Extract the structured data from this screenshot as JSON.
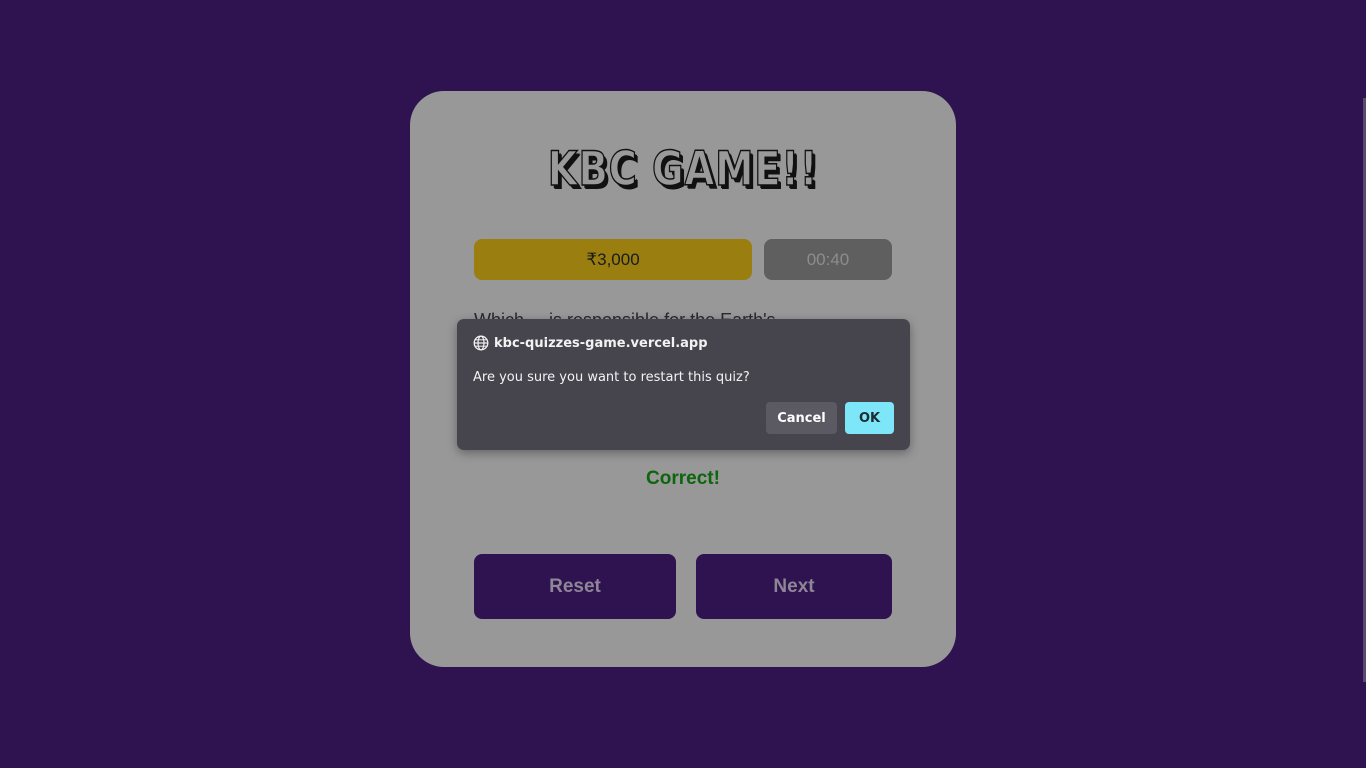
{
  "game": {
    "title": "KBC GAME!!",
    "prize": "₹3,000",
    "timer": "00:40",
    "question": "Which ... is responsible for the Earth's ...",
    "result": "Correct!",
    "reset_label": "Reset",
    "next_label": "Next"
  },
  "dialog": {
    "origin": "kbc-quizzes-game.vercel.app",
    "message": "Are you sure you want to restart this quiz?",
    "cancel_label": "Cancel",
    "ok_label": "OK",
    "origin_icon": "globe-icon"
  },
  "colors": {
    "background": "#2f1350",
    "card": "#999899",
    "prize": "#9a7e10",
    "timer": "#5f5f5f",
    "correct": "#0d650d",
    "ok_button": "#7ee6f9"
  }
}
